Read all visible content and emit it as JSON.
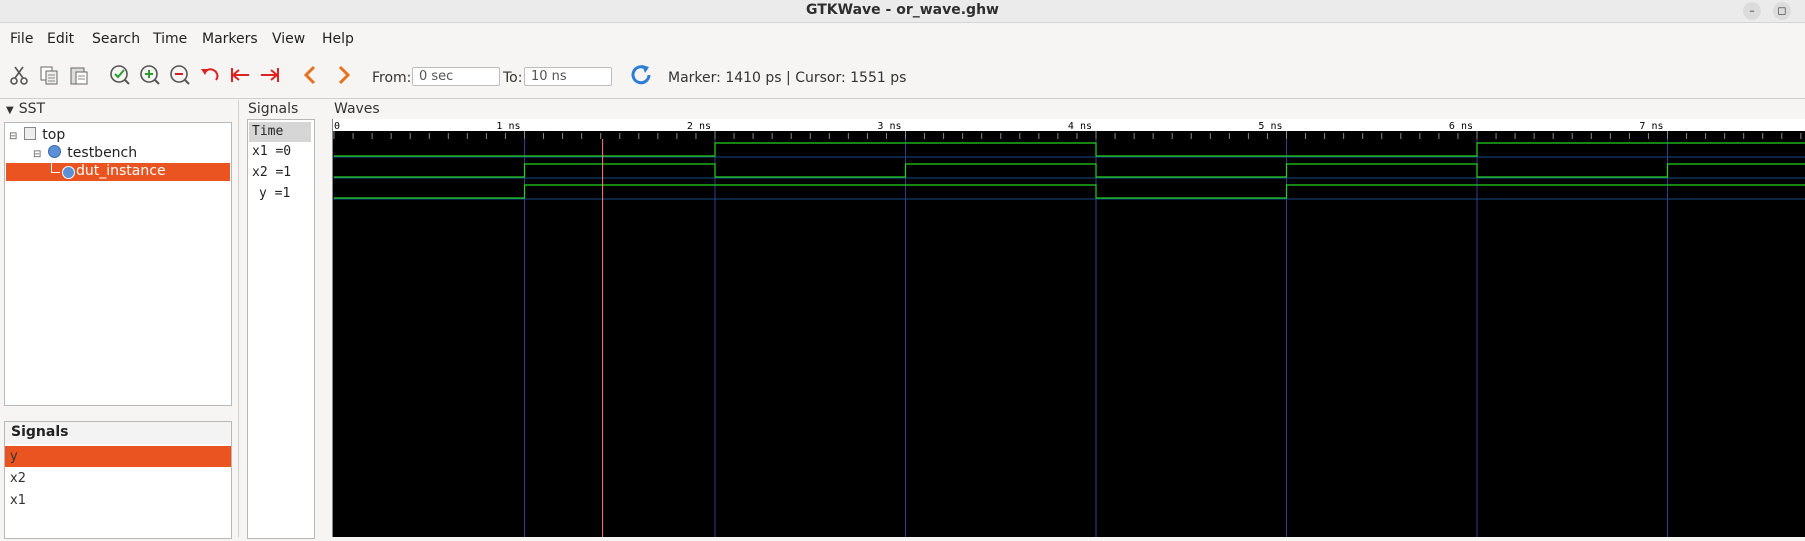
{
  "window": {
    "title": "GTKWave - or_wave.ghw",
    "minimize": "–",
    "maximize": "◻"
  },
  "menu": [
    "File",
    "Edit",
    "Search",
    "Time",
    "Markers",
    "View",
    "Help"
  ],
  "toolbar": {
    "from_label": "From:",
    "from_value": "0 sec",
    "to_label": "To:",
    "to_value": "10 ns",
    "status": "Marker: 1410 ps  |  Cursor: 1551 ps"
  },
  "sst": {
    "header": "SST",
    "tree": [
      {
        "label": "top"
      },
      {
        "label": "testbench"
      },
      {
        "label": "dut_instance",
        "selected": true
      }
    ]
  },
  "signals_panel": {
    "header": "Signals",
    "items": [
      {
        "label": "y",
        "selected": true
      },
      {
        "label": "x2"
      },
      {
        "label": "x1"
      }
    ]
  },
  "signal_names": {
    "header": "Signals",
    "time_label": "Time",
    "rows": [
      "x1 =0",
      "x2 =1",
      "y =1"
    ]
  },
  "waves": {
    "header": "Waves",
    "tick_labels": [
      "0",
      "1 ns",
      "2 ns",
      "3 ns",
      "4 ns",
      "5 ns",
      "6 ns",
      "7 ns"
    ],
    "time_unit": "ns",
    "marker_ps": 1410,
    "cursor_ps": 1551,
    "signals": [
      {
        "name": "x1",
        "transitions": [
          [
            0,
            0
          ],
          [
            2,
            1
          ],
          [
            4,
            0
          ],
          [
            6,
            1
          ]
        ]
      },
      {
        "name": "x2",
        "transitions": [
          [
            0,
            0
          ],
          [
            1,
            1
          ],
          [
            2,
            0
          ],
          [
            3,
            1
          ],
          [
            4,
            0
          ],
          [
            5,
            1
          ],
          [
            6,
            0
          ],
          [
            7,
            1
          ]
        ]
      },
      {
        "name": "y",
        "transitions": [
          [
            0,
            0
          ],
          [
            1,
            1
          ],
          [
            4,
            0
          ],
          [
            5,
            1
          ]
        ]
      }
    ],
    "colors": {
      "wave": "#22d21e",
      "grid": "#3a3a8a",
      "marker": "#ff8080",
      "cursor": "#ffffff"
    }
  }
}
